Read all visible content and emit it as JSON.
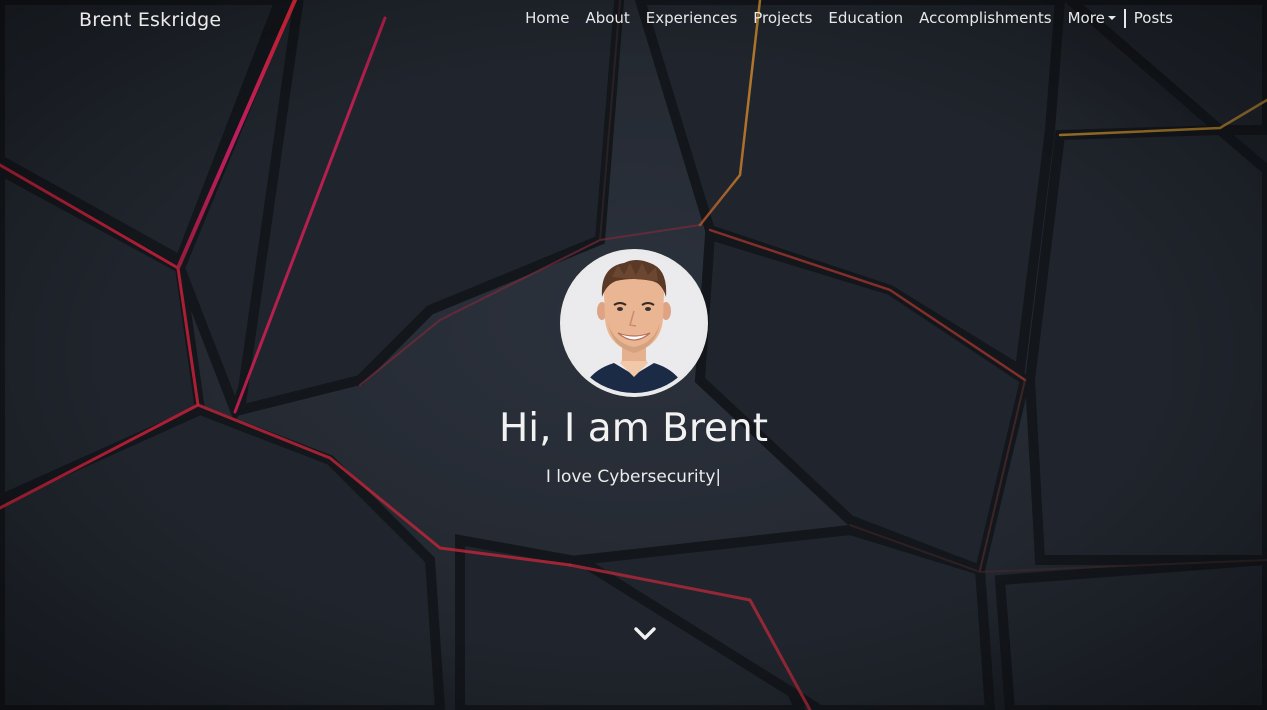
{
  "brand": "Brent Eskridge",
  "nav": {
    "items": [
      {
        "label": "Home"
      },
      {
        "label": "About"
      },
      {
        "label": "Experiences"
      },
      {
        "label": "Projects"
      },
      {
        "label": "Education"
      },
      {
        "label": "Accomplishments"
      }
    ],
    "more_label": "More",
    "posts_label": "Posts"
  },
  "hero": {
    "greeting": "Hi, I am Brent",
    "tagline": "I love Cybersecurity",
    "cursor": "|"
  },
  "icons": {
    "scroll": "chevron-down-icon",
    "more": "caret-down-icon"
  },
  "colors": {
    "text": "#f2f2f2",
    "accent_red": "#e0243c",
    "accent_magenta": "#d4226e",
    "accent_orange": "#d8772a",
    "background": "#232830"
  }
}
